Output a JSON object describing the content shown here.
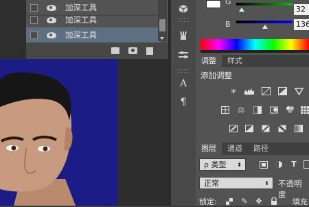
{
  "history": {
    "items": [
      {
        "label": "加深工具"
      },
      {
        "label": "加深工具"
      },
      {
        "label": "加深工具"
      }
    ]
  },
  "color": {
    "g_label": "G",
    "b_label": "B",
    "g_value": "32",
    "b_value": "136"
  },
  "adjust": {
    "tabs": [
      "调整",
      "样式"
    ],
    "heading": "添加调整"
  },
  "toolstrip": {
    "char_icon": "A",
    "para_icon": "¶"
  },
  "layers": {
    "tabs": [
      "图层",
      "通道",
      "路径"
    ],
    "filter_label": "ρ 类型",
    "blend_mode": "正常",
    "opacity_label": "不透明度",
    "lock_label": "锁定:",
    "fill_label": "填充"
  }
}
